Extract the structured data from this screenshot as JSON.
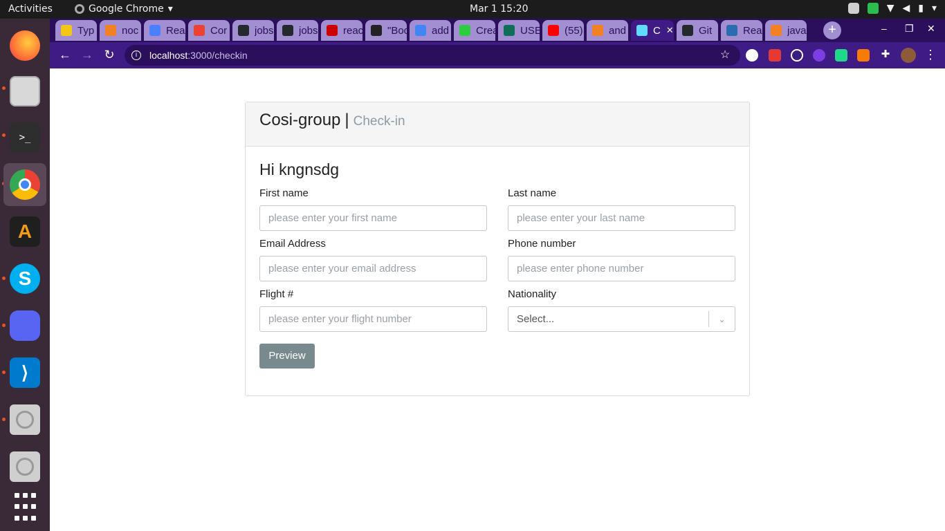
{
  "system": {
    "activities": "Activities",
    "app_name": "Google Chrome",
    "clock": "Mar 1  15:20"
  },
  "dock": {
    "items": [
      {
        "name": "firefox",
        "color": "#ff7139"
      },
      {
        "name": "files",
        "color": "#cfcfcf"
      },
      {
        "name": "terminal",
        "color": "#2e2e2e"
      },
      {
        "name": "chrome",
        "color": "#4285f4"
      },
      {
        "name": "alacritty",
        "color": "#1f1f1f"
      },
      {
        "name": "skype",
        "color": "#00aff0"
      },
      {
        "name": "discord",
        "color": "#5865f2"
      },
      {
        "name": "vscode",
        "color": "#007acc"
      },
      {
        "name": "disk-1",
        "color": "#d0d0d0"
      },
      {
        "name": "disk-2",
        "color": "#d0d0d0"
      },
      {
        "name": "app-grid",
        "color": "#ffffff"
      }
    ]
  },
  "browser": {
    "tabs": [
      {
        "title": "Typ",
        "color": "#f5c518"
      },
      {
        "title": "noc",
        "color": "#f48024"
      },
      {
        "title": "Rea",
        "color": "#4a7fff"
      },
      {
        "title": "Cor",
        "color": "#ea4335"
      },
      {
        "title": "jobs",
        "color": "#24292e"
      },
      {
        "title": "jobs",
        "color": "#24292e"
      },
      {
        "title": "reac",
        "color": "#cc0000"
      },
      {
        "title": "\"Boo",
        "color": "#222222"
      },
      {
        "title": "add",
        "color": "#4285f4"
      },
      {
        "title": "Crea",
        "color": "#2ecc40"
      },
      {
        "title": "USE",
        "color": "#0f6e5a"
      },
      {
        "title": "(55)",
        "color": "#ff0000"
      },
      {
        "title": "and",
        "color": "#f48024"
      },
      {
        "title": "C",
        "color": "#61dafb"
      },
      {
        "title": "Git",
        "color": "#24292e"
      },
      {
        "title": "Rea",
        "color": "#2b6cb0"
      },
      {
        "title": "java",
        "color": "#f48024"
      }
    ],
    "new_tab": "+",
    "url_host": "localhost",
    "url_path": ":3000/checkin"
  },
  "form": {
    "brand": "Cosi-group",
    "separator": "|",
    "subtitle": "Check-in",
    "greeting": "Hi kngnsdg",
    "first_name": {
      "label": "First name",
      "placeholder": "please enter your first name"
    },
    "last_name": {
      "label": "Last name",
      "placeholder": "please enter your last name"
    },
    "email": {
      "label": "Email Address",
      "placeholder": "please enter your email address"
    },
    "phone": {
      "label": "Phone number",
      "placeholder": "please enter phone number"
    },
    "flight": {
      "label": "Flight #",
      "placeholder": "please enter your flight number"
    },
    "nationality": {
      "label": "Nationality",
      "value": "Select..."
    },
    "preview_label": "Preview"
  }
}
